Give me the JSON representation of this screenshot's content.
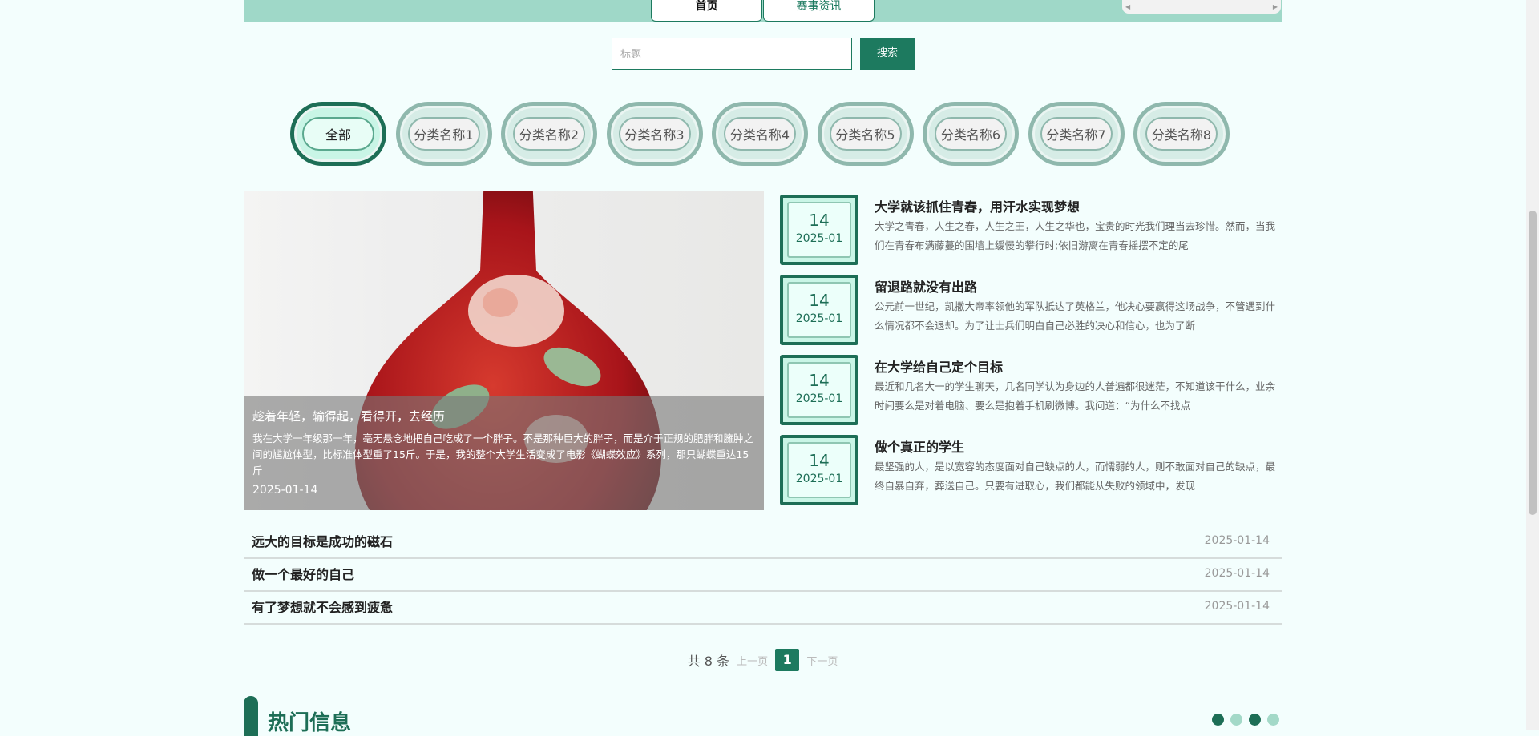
{
  "nav": {
    "tabs": [
      {
        "label": "首页"
      },
      {
        "label": "赛事资讯"
      }
    ]
  },
  "search": {
    "placeholder": "标题",
    "value": "",
    "button": "搜索"
  },
  "categories": [
    {
      "label": "全部",
      "active": true
    },
    {
      "label": "分类名称1"
    },
    {
      "label": "分类名称2"
    },
    {
      "label": "分类名称3"
    },
    {
      "label": "分类名称4"
    },
    {
      "label": "分类名称5"
    },
    {
      "label": "分类名称6"
    },
    {
      "label": "分类名称7"
    },
    {
      "label": "分类名称8"
    }
  ],
  "featured": {
    "title": "趁着年轻，输得起，看得开，去经历",
    "body": "我在大学一年级那一年，毫无悬念地把自己吃成了一个胖子。不是那种巨大的胖子，而是介于正规的肥胖和臃肿之间的尴尬体型，比标准体型重了15斤。于是，我的整个大学生活变成了电影《蝴蝶效应》系列，那只蝴蝶重达15斤",
    "date": "2025-01-14"
  },
  "articles": [
    {
      "day": "14",
      "ym": "2025-01",
      "title": "大学就该抓住青春，用汗水实现梦想",
      "summary": "大学之青春，人生之春，人生之王，人生之华也，宝贵的时光我们理当去珍惜。然而，当我们在青春布满藤蔓的围墙上缓慢的攀行时;依旧游离在青春摇摆不定的尾"
    },
    {
      "day": "14",
      "ym": "2025-01",
      "title": "留退路就没有出路",
      "summary": "公元前一世纪，凯撒大帝率领他的军队抵达了英格兰，他决心要赢得这场战争，不管遇到什么情况都不会退却。为了让士兵们明白自己必胜的决心和信心，也为了断"
    },
    {
      "day": "14",
      "ym": "2025-01",
      "title": "在大学给自己定个目标",
      "summary": "最近和几名大一的学生聊天，几名同学认为身边的人普遍都很迷茫，不知道该干什么，业余时间要么是对着电脑、要么是抱着手机刷微博。我问道：“为什么不找点"
    },
    {
      "day": "14",
      "ym": "2025-01",
      "title": "做个真正的学生",
      "summary": "最坚强的人，是以宽容的态度面对自己缺点的人，而懦弱的人，则不敢面对自己的缺点，最终自暴自弃，葬送自己。只要有进取心，我们都能从失败的领域中，发现"
    }
  ],
  "list": [
    {
      "title": "远大的目标是成功的磁石",
      "date": "2025-01-14"
    },
    {
      "title": "做一个最好的自己",
      "date": "2025-01-14"
    },
    {
      "title": "有了梦想就不会感到疲惫",
      "date": "2025-01-14"
    }
  ],
  "pagination": {
    "total": "共 8 条",
    "prev": "上一页",
    "current": "1",
    "next": "下一页"
  },
  "hot": {
    "title": "热门信息"
  },
  "colors": {
    "accent": "#1d7a5f",
    "topbar": "#9fd8c8",
    "background": "#f3fefd",
    "dot_light": "#a3d9c8"
  }
}
